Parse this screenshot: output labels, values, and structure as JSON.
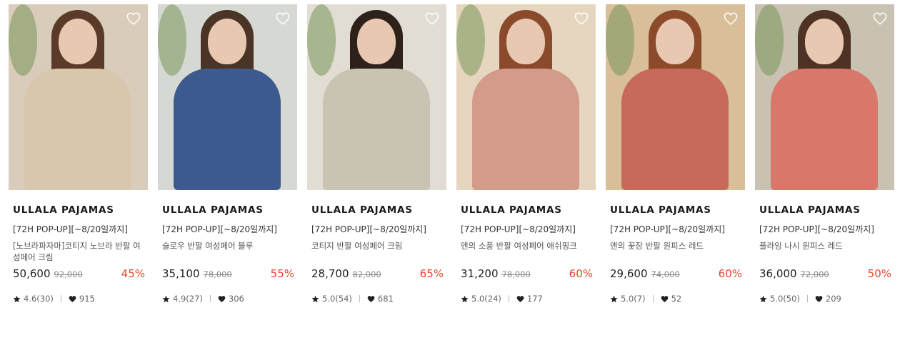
{
  "colors": {
    "discount": "#e8452c",
    "text": "#222222"
  },
  "products": [
    {
      "brand": "ULLALA PAJAMAS",
      "promo": "[72H POP-UP][~8/20일까지]",
      "name": "[노브라파자마]코티지 노브라 반팔 여성페어 크림",
      "price": "50,600",
      "original_price": "92,000",
      "discount": "45%",
      "rating": "4.6(30)",
      "likes": "915",
      "wall_color": "#d9ccbb",
      "hair_color": "#5a3b2a",
      "outfit_color": "#d8c6ad"
    },
    {
      "brand": "ULLALA PAJAMAS",
      "promo": "[72H POP-UP][~8/20일까지]",
      "name": "슬로우 반팔 여성페어 블루",
      "price": "35,100",
      "original_price": "78,000",
      "discount": "55%",
      "rating": "4.9(27)",
      "likes": "306",
      "wall_color": "#d6d9d3",
      "hair_color": "#4a3426",
      "outfit_color": "#3d5a8e"
    },
    {
      "brand": "ULLALA PAJAMAS",
      "promo": "[72H POP-UP][~8/20일까지]",
      "name": "코티지 반팔 여성페어 크림",
      "price": "28,700",
      "original_price": "82,000",
      "discount": "65%",
      "rating": "5.0(54)",
      "likes": "681",
      "wall_color": "#e2ddd3",
      "hair_color": "#2e211a",
      "outfit_color": "#c9c3b4"
    },
    {
      "brand": "ULLALA PAJAMAS",
      "promo": "[72H POP-UP][~8/20일까지]",
      "name": "앤의 소풍 반팔 여성페어 애쉬핑크",
      "price": "31,200",
      "original_price": "78,000",
      "discount": "60%",
      "rating": "5.0(24)",
      "likes": "177",
      "wall_color": "#e6d6bf",
      "hair_color": "#8a4a2c",
      "outfit_color": "#d49a8a"
    },
    {
      "brand": "ULLALA PAJAMAS",
      "promo": "[72H POP-UP][~8/20일까지]",
      "name": "앤의 꽃잠 반팔 원피스 레드",
      "price": "29,600",
      "original_price": "74,000",
      "discount": "60%",
      "rating": "5.0(7)",
      "likes": "52",
      "wall_color": "#d8bf9a",
      "hair_color": "#8c4a2a",
      "outfit_color": "#c76a5a"
    },
    {
      "brand": "ULLALA PAJAMAS",
      "promo": "[72H POP-UP][~8/20일까지]",
      "name": "플라잉 나시 원피스 레드",
      "price": "36,000",
      "original_price": "72,000",
      "discount": "50%",
      "rating": "5.0(50)",
      "likes": "209",
      "wall_color": "#c9c1b2",
      "hair_color": "#4e3324",
      "outfit_color": "#d7786b"
    }
  ]
}
